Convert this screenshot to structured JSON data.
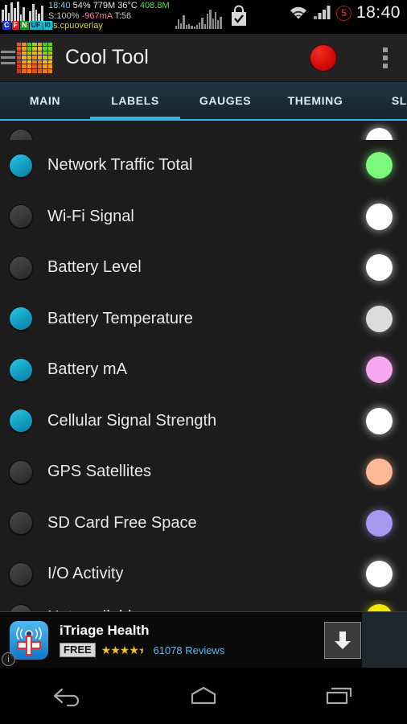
{
  "status_bar": {
    "overlay": {
      "line1": {
        "time": "18:40",
        "battery": "54%",
        "mem": "779M",
        "temp": "36°C",
        "net": "408.8M"
      },
      "line2": {
        "soc": "S:100%",
        "current": "-967mA",
        "temp": "T:56"
      },
      "line3": "ds.cpuoverlay",
      "badges": [
        "C",
        "F",
        "N",
        "UF",
        "I0"
      ]
    },
    "icons": {
      "wifi": "wifi-icon",
      "cellular": "cellular-signal-icon",
      "play_store": "play-store-bag-icon",
      "cpu_graph": "cpu-history-graph-icon"
    },
    "alarm_badge": "5",
    "clock": "18:40"
  },
  "app_bar": {
    "drawer_icon": "hamburger-menu-icon",
    "app_icon": "equalizer-app-icon",
    "title": "Cool Tool",
    "record_button": "record-button",
    "overflow_button": "overflow-menu-icon"
  },
  "tabs": {
    "selected": "LABELS",
    "items": [
      {
        "label": "MAIN",
        "selected": false
      },
      {
        "label": "LABELS",
        "selected": true
      },
      {
        "label": "GAUGES",
        "selected": false
      },
      {
        "label": "THEMING",
        "selected": false
      },
      {
        "label": "SLID",
        "selected": false
      }
    ],
    "accent_color": "#33b5e5"
  },
  "list": {
    "rows": [
      {
        "label": "",
        "enabled": false,
        "color": "#ffffff",
        "partial": "top"
      },
      {
        "label": "Network Traffic Total",
        "enabled": true,
        "color": "#7cf87c",
        "partial": ""
      },
      {
        "label": "Wi-Fi Signal",
        "enabled": false,
        "color": "#ffffff",
        "partial": ""
      },
      {
        "label": "Battery Level",
        "enabled": false,
        "color": "#ffffff",
        "partial": ""
      },
      {
        "label": "Battery Temperature",
        "enabled": true,
        "color": "#dcdcdc",
        "partial": ""
      },
      {
        "label": "Battery mA",
        "enabled": true,
        "color": "#f5a8f0",
        "partial": ""
      },
      {
        "label": "Cellular Signal Strength",
        "enabled": true,
        "color": "#ffffff",
        "partial": ""
      },
      {
        "label": "GPS Satellites",
        "enabled": false,
        "color": "#ffb894",
        "partial": ""
      },
      {
        "label": "SD Card Free Space",
        "enabled": false,
        "color": "#a898f0",
        "partial": ""
      },
      {
        "label": "I/O Activity",
        "enabled": false,
        "color": "#ffffff",
        "partial": ""
      },
      {
        "label": "Net available",
        "enabled": false,
        "color": "#f2e800",
        "partial": "bottom"
      }
    ],
    "toggle_on_color": "#14a2c4",
    "toggle_off_color": "#3a3a3a"
  },
  "ad": {
    "title": "iTriage Health",
    "price_badge": "FREE",
    "stars": "★★★★",
    "half_star": "★",
    "reviews": "61078 Reviews",
    "download_icon": "download-arrow-icon",
    "info_icon": "ad-info-icon",
    "app_icon": "itriage-health-icon"
  },
  "nav_bar": {
    "back": "back-icon",
    "home": "home-icon",
    "recents": "recents-icon"
  }
}
